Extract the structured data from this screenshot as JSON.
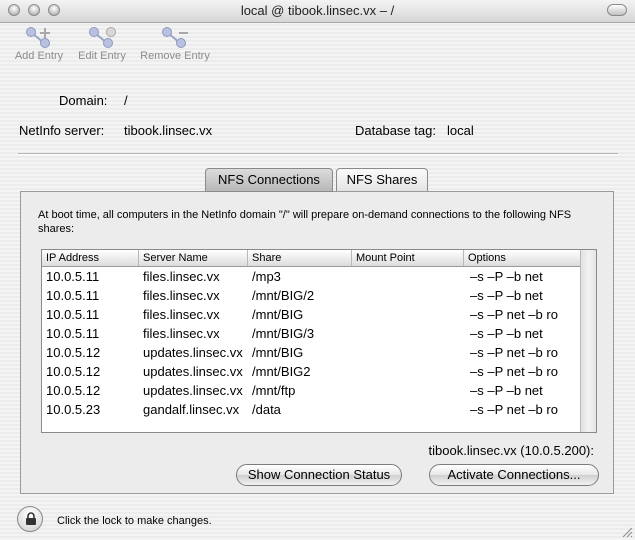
{
  "window": {
    "title": "local @ tibook.linsec.vx – /"
  },
  "toolbar": {
    "add_entry": "Add Entry",
    "edit_entry": "Edit Entry",
    "remove_entry": "Remove Entry"
  },
  "info": {
    "domain_label": "Domain:",
    "domain_value": "/",
    "server_label": "NetInfo server:",
    "server_value": "tibook.linsec.vx",
    "dbtag_label": "Database tag:",
    "dbtag_value": "local"
  },
  "tabs": [
    {
      "label": "NFS Connections",
      "selected": true
    },
    {
      "label": "NFS Shares",
      "selected": false
    }
  ],
  "panel": {
    "intro_text": "At boot time, all computers in the NetInfo domain \"/\" will prepare on-demand connections to the following NFS shares:",
    "columns": [
      "IP Address",
      "Server Name",
      "Share",
      "Mount Point",
      "Options"
    ],
    "rows": [
      {
        "ip": "10.0.5.11",
        "server": "files.linsec.vx",
        "share": "/mp3",
        "mount": "",
        "options": "–s –P –b net"
      },
      {
        "ip": "10.0.5.11",
        "server": "files.linsec.vx",
        "share": "/mnt/BIG/2",
        "mount": "",
        "options": "–s –P –b net"
      },
      {
        "ip": "10.0.5.11",
        "server": "files.linsec.vx",
        "share": "/mnt/BIG",
        "mount": "",
        "options": "–s –P net –b ro"
      },
      {
        "ip": "10.0.5.11",
        "server": "files.linsec.vx",
        "share": "/mnt/BIG/3",
        "mount": "",
        "options": "–s –P –b net"
      },
      {
        "ip": "10.0.5.12",
        "server": "updates.linsec.vx",
        "share": "/mnt/BIG",
        "mount": "",
        "options": "–s –P net –b ro"
      },
      {
        "ip": "10.0.5.12",
        "server": "updates.linsec.vx",
        "share": "/mnt/BIG2",
        "mount": "",
        "options": "–s –P net –b ro"
      },
      {
        "ip": "10.0.5.12",
        "server": "updates.linsec.vx",
        "share": "/mnt/ftp",
        "mount": "",
        "options": "–s –P –b net"
      },
      {
        "ip": "10.0.5.23",
        "server": "gandalf.linsec.vx",
        "share": "/data",
        "mount": "",
        "options": "–s –P net –b ro"
      }
    ],
    "server_host": "tibook.linsec.vx (10.0.5.200):",
    "show_status_button": "Show Connection Status",
    "activate_button": "Activate Connections..."
  },
  "lock": {
    "message": "Click the lock to make changes."
  },
  "icons": {
    "close": "close-button-icon",
    "minimize": "minimize-button-icon",
    "zoom": "zoom-button-icon",
    "toolbar_toggle": "toolbar-toggle-icon",
    "add": "add-entry-icon",
    "edit": "edit-entry-icon",
    "remove": "remove-entry-icon",
    "lock": "lock-icon",
    "resize": "resize-grip-icon"
  }
}
